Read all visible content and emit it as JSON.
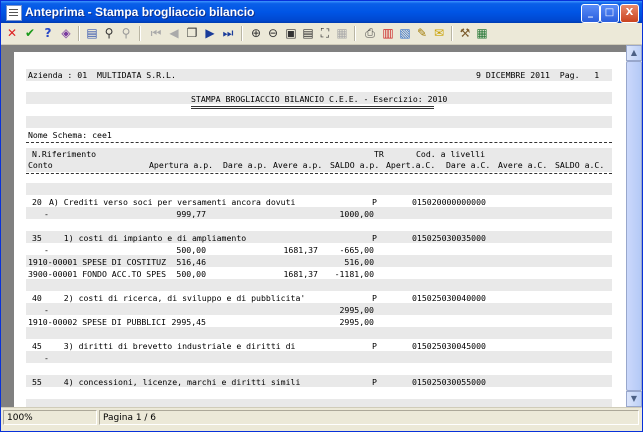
{
  "window": {
    "title": "Anteprima - Stampa brogliaccio bilancio",
    "minimize_label": "_",
    "maximize_label": "□",
    "close_label": "X"
  },
  "toolbar": {
    "icons": [
      "close-icon",
      "check-icon",
      "help-icon",
      "book-icon",
      "setup-icon",
      "find-icon",
      "find-next-icon",
      "first-page-icon",
      "prev-page-icon",
      "copy-icon",
      "next-page-icon",
      "last-page-icon",
      "zoom-in-icon",
      "zoom-out-icon",
      "fit-page-icon",
      "fit-width-icon",
      "full-screen-icon",
      "thumbnails-icon",
      "printer-icon",
      "pdf-icon",
      "export-icon",
      "edit-icon",
      "email-icon",
      "tools-icon",
      "calculator-icon"
    ]
  },
  "report": {
    "header_left": "Azienda : 01  MULTIDATA S.R.L.",
    "header_right": "9 DICEMBRE 2011  Pag.   1",
    "title": "STAMPA BROGLIACCIO BILANCIO C.E.E. - Esercizio: 2010",
    "schema": "Nome Schema: cee1",
    "col_nrif": "N.Riferimento",
    "col_tr": "TR",
    "col_cod": "Cod. a livelli",
    "col_conto": "Conto",
    "col_apertura": "Apertura a.p.",
    "col_dare_ap": "Dare a.p.",
    "col_avere_ap": "Avere a.p.",
    "col_saldo_ap": "SALDO a.p.",
    "col_apert_ac": "Apert.a.C.",
    "col_dare_ac": "Dare a.C.",
    "col_avere_ac": "Avere a.C.",
    "col_saldo_ac": "SALDO a.C.",
    "rows": [
      {
        "num": "20",
        "desc": "A) Crediti verso soci per versamenti ancora dovuti",
        "tr": "P",
        "code": "015020000000000"
      },
      {
        "conto": "-",
        "apertura": "999,77",
        "dare": "",
        "avere": "",
        "saldo": "1000,00"
      },
      {
        "num": "35",
        "desc": "   1) costi di impianto e di ampliamento",
        "tr": "P",
        "code": "015025030035000"
      },
      {
        "conto": "-",
        "apertura": "500,00",
        "dare": "",
        "avere": "1681,37",
        "saldo": "-665,00"
      },
      {
        "conto": "1910-00001 SPESE DI COSTITUZ",
        "apertura": "516,46",
        "dare": "",
        "avere": "",
        "saldo": "516,00"
      },
      {
        "conto": "3900-00001 FONDO ACC.TO SPES",
        "apertura": "500,00",
        "dare": "",
        "avere": "1681,37",
        "saldo": "-1181,00"
      },
      {
        "num": "40",
        "desc": "   2) costi di ricerca, di sviluppo e di pubblicita'",
        "tr": "P",
        "code": "015025030040000"
      },
      {
        "conto": "-",
        "apertura": "",
        "dare": "",
        "avere": "",
        "saldo": "2995,00"
      },
      {
        "conto": "1910-00002 SPESE DI PUBBLICI",
        "apertura": "2995,45",
        "dare": "",
        "avere": "",
        "saldo": "2995,00"
      },
      {
        "num": "45",
        "desc": "   3) diritti di brevetto industriale e diritti di",
        "tr": "P",
        "code": "015025030045000"
      },
      {
        "conto": "-",
        "apertura": "",
        "dare": "",
        "avere": "",
        "saldo": ""
      },
      {
        "num": "55",
        "desc": "   4) concessioni, licenze, marchi e diritti simili",
        "tr": "P",
        "code": "015025030055000"
      }
    ]
  },
  "status": {
    "zoom": "100%",
    "page": "Pagina 1 / 6"
  }
}
